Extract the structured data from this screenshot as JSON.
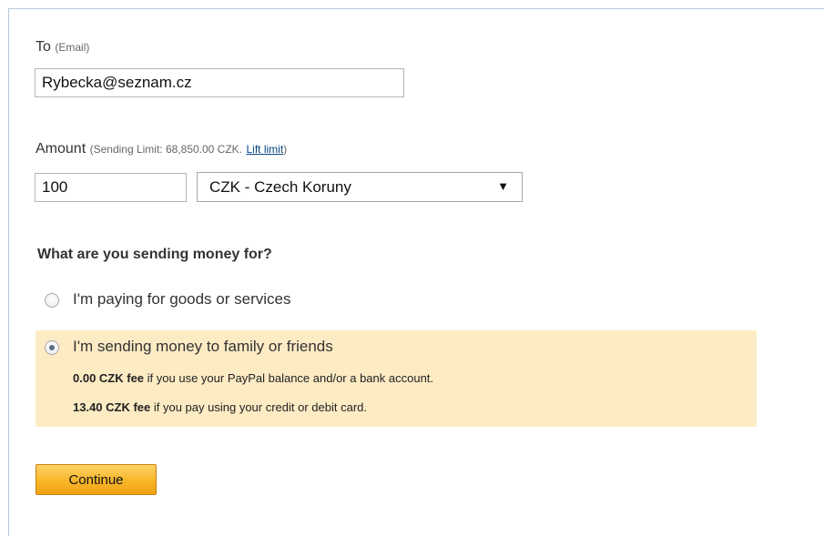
{
  "to": {
    "label": "To",
    "hint": "(Email)",
    "value": "Rybecka@seznam.cz"
  },
  "amount": {
    "label": "Amount",
    "hint_prefix": "(Sending Limit: 68,850.00 CZK.",
    "lift_limit_link": "Lift limit",
    "hint_suffix": ")",
    "value": "100",
    "currency_selected": "CZK - Czech Koruny",
    "dropdown_arrow": "▼"
  },
  "purpose": {
    "question": "What are you sending money for?",
    "options": [
      {
        "label": "I'm paying for goods or services",
        "selected": false
      },
      {
        "label": "I'm sending money to family or friends",
        "selected": true,
        "fees": [
          {
            "amount": "0.00 CZK fee",
            "text": " if you use your PayPal balance and/or a bank account."
          },
          {
            "amount": "13.40 CZK fee",
            "text": " if you pay using your credit or debit card."
          }
        ]
      }
    ]
  },
  "continue_label": "Continue",
  "colors": {
    "highlight": "#fdebc4",
    "button": "#f8b628",
    "link": "#084482",
    "frame_border": "#b9c8d8"
  }
}
